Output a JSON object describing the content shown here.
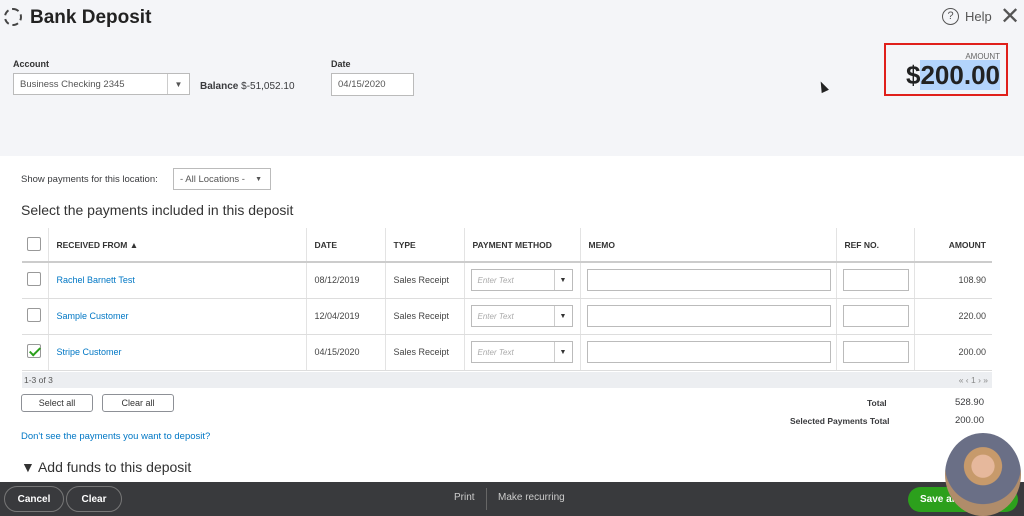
{
  "header": {
    "title": "Bank Deposit",
    "help": "Help"
  },
  "account": {
    "label": "Account",
    "value": "Business Checking 2345",
    "balance_label": "Balance",
    "balance": "$-51,052.10"
  },
  "date": {
    "label": "Date",
    "value": "04/15/2020"
  },
  "amount": {
    "label": "AMOUNT",
    "currency": "$",
    "value": "200.00"
  },
  "filter": {
    "label": "Show payments for this location:",
    "value": "- All Locations -"
  },
  "section_title": "Select the payments included in this deposit",
  "table": {
    "columns": [
      "RECEIVED FROM ▲",
      "DATE",
      "TYPE",
      "PAYMENT METHOD",
      "MEMO",
      "REF NO.",
      "AMOUNT"
    ],
    "payment_placeholder": "Enter Text",
    "rows": [
      {
        "checked": false,
        "received_from": "Rachel Barnett Test",
        "date": "08/12/2019",
        "type": "Sales Receipt",
        "amount": "108.90"
      },
      {
        "checked": false,
        "received_from": "Sample Customer",
        "date": "12/04/2019",
        "type": "Sales Receipt",
        "amount": "220.00"
      },
      {
        "checked": true,
        "received_from": "Stripe Customer",
        "date": "04/15/2020",
        "type": "Sales Receipt",
        "amount": "200.00"
      }
    ],
    "pagination": "1-3 of 3",
    "pager": "« ‹ 1 › »"
  },
  "buttons": {
    "select_all": "Select all",
    "clear_all": "Clear all"
  },
  "totals": {
    "total_label": "Total",
    "total": "528.90",
    "selected_label": "Selected Payments Total",
    "selected": "200.00"
  },
  "missing_link": "Don't see the payments you want to deposit?",
  "add_funds": "▼ Add funds to this deposit",
  "footer": {
    "cancel": "Cancel",
    "clear": "Clear",
    "print": "Print",
    "recurring": "Make recurring",
    "save": "Save an"
  }
}
